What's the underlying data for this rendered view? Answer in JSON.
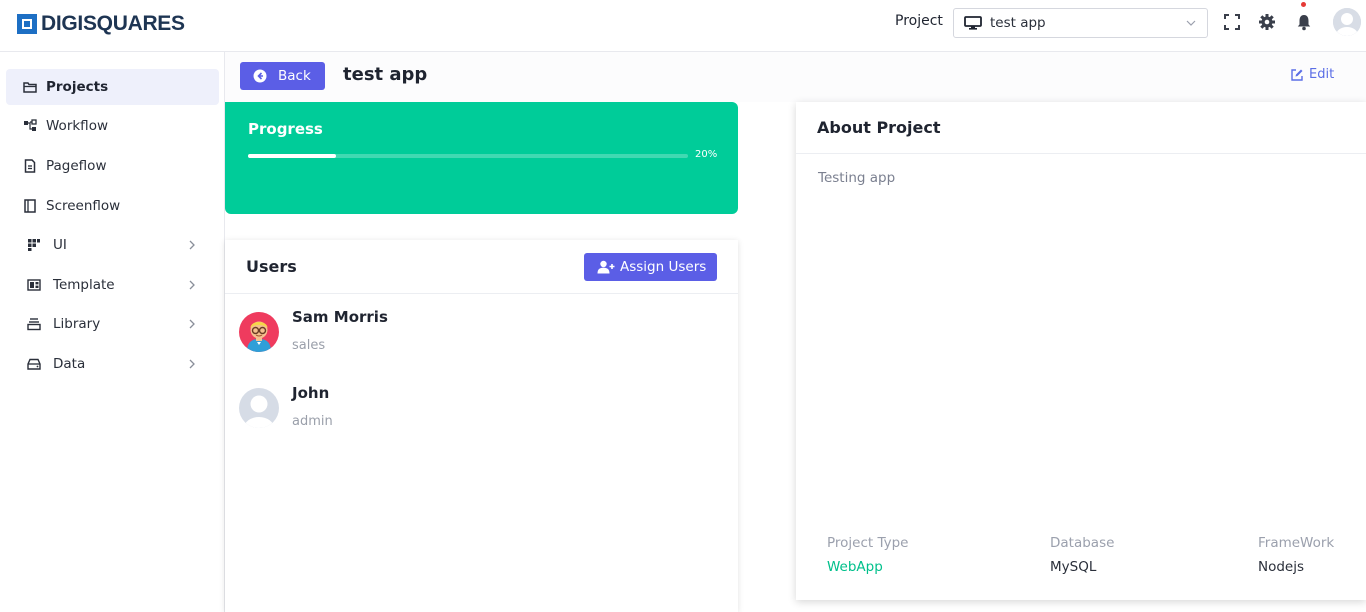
{
  "app": {
    "brand": "DIGISQUARES"
  },
  "header": {
    "project_label": "Project",
    "project_selected": "test app"
  },
  "sidebar": {
    "items": [
      {
        "label": "Projects",
        "icon": "folder-icon",
        "active": true
      },
      {
        "label": "Workflow",
        "icon": "workflow-icon"
      },
      {
        "label": "Pageflow",
        "icon": "page-icon"
      },
      {
        "label": "Screenflow",
        "icon": "book-icon"
      },
      {
        "label": "UI",
        "icon": "grid-icon",
        "expandable": true
      },
      {
        "label": "Template",
        "icon": "template-icon",
        "expandable": true
      },
      {
        "label": "Library",
        "icon": "library-icon",
        "expandable": true
      },
      {
        "label": "Data",
        "icon": "drive-icon",
        "expandable": true
      }
    ]
  },
  "page": {
    "back_label": "Back",
    "title": "test app",
    "edit_label": "Edit"
  },
  "progress": {
    "title": "Progress",
    "value_percent": 20,
    "value_text": "20%",
    "color": "#00cc99"
  },
  "users": {
    "title": "Users",
    "assign_label": "Assign Users",
    "list": [
      {
        "name": "Sam Morris",
        "role": "sales"
      },
      {
        "name": "John",
        "role": "admin"
      }
    ]
  },
  "about": {
    "title": "About Project",
    "description": "Testing app",
    "meta": [
      {
        "label": "Project Type",
        "value": "WebApp"
      },
      {
        "label": "Database",
        "value": "MySQL"
      },
      {
        "label": "FrameWork",
        "value": "Nodejs"
      }
    ]
  },
  "colors": {
    "primary": "#5b5ee6",
    "accent": "#00cc99"
  }
}
